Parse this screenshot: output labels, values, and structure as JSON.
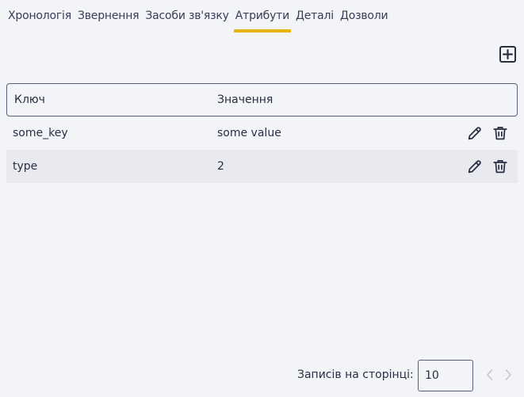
{
  "tabs": [
    {
      "label": "Хронологія"
    },
    {
      "label": "Звернення"
    },
    {
      "label": "Засоби зв'язку"
    },
    {
      "label": "Атрибути",
      "active": true
    },
    {
      "label": "Деталі"
    },
    {
      "label": "Дозволи"
    }
  ],
  "table": {
    "headers": {
      "key": "Ключ",
      "value": "Значення"
    },
    "rows": [
      {
        "key": "some_key",
        "value": "some value"
      },
      {
        "key": "type",
        "value": "2"
      }
    ]
  },
  "pagination": {
    "label": "Записів на сторінці:",
    "page_size": "10"
  },
  "icons": {
    "add": "plus-square-icon",
    "edit": "pencil-icon",
    "delete": "trash-icon",
    "prev": "chevron-left-icon",
    "next": "chevron-right-icon"
  },
  "colors": {
    "accent": "#eab308",
    "background": "#f3f4f8",
    "alt_row": "#e9eaf0"
  }
}
